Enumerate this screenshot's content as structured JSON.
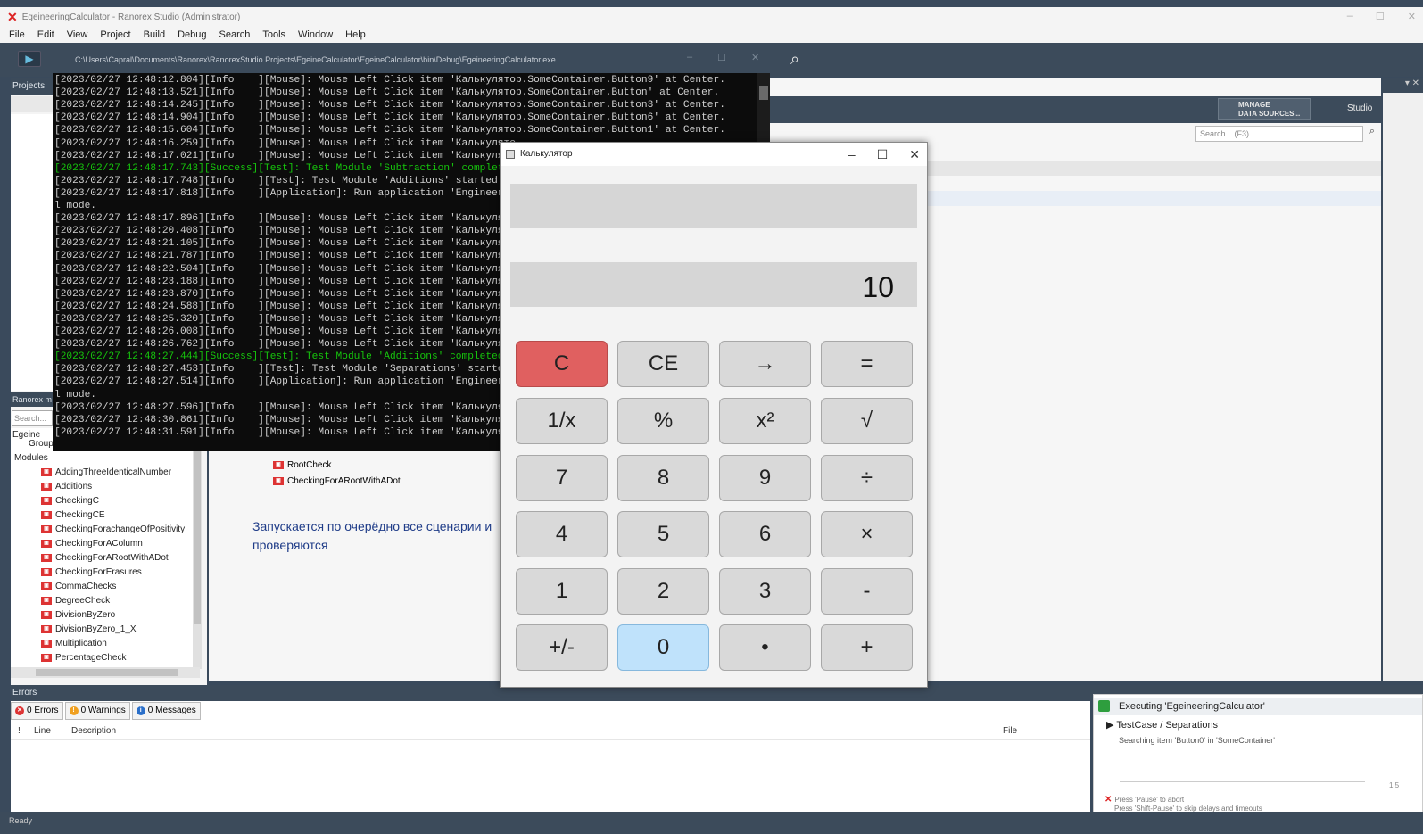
{
  "window": {
    "title": "EgeineeringCalculator - Ranorex Studio (Administrator)",
    "minimize": "–",
    "maximize": "☐",
    "close": "✕"
  },
  "menu": [
    "File",
    "Edit",
    "View",
    "Project",
    "Build",
    "Debug",
    "Search",
    "Tools",
    "Window",
    "Help"
  ],
  "toolbar": {
    "path": "C:\\Users\\Capral\\Documents\\Ranorex\\RanorexStudio Projects\\EgeineCalculator\\EgeineCalculator\\bin\\Debug\\EgeineeringCalculator.exe",
    "run_icon": "▶",
    "ctl_min": "–",
    "ctl_max": "☐",
    "ctl_close": "✕"
  },
  "projects_panel": {
    "title": "Projects"
  },
  "module_panel": {
    "title": "Ranorex m",
    "search_placeholder": "Search...",
    "root": "Egeine",
    "group": "Group",
    "modules_label": "Modules",
    "modules": [
      "AddingThreeIdenticalNumber",
      "Additions",
      "CheckingC",
      "CheckingCE",
      "CheckingForachangeOfPositivity",
      "CheckingForAColumn",
      "CheckingForARootWithADot",
      "CheckingForErasures",
      "CommaChecks",
      "DegreeCheck",
      "DivisionByZero",
      "DivisionByZero_1_X",
      "Multiplication",
      "PercentageCheck"
    ]
  },
  "console": {
    "lines": [
      {
        "t": "[2023/02/27 12:48:12.804][Info    ][Mouse]: Mouse Left Click item 'Калькулятор.SomeContainer.Button9' at Center.",
        "s": false
      },
      {
        "t": "[2023/02/27 12:48:13.521][Info    ][Mouse]: Mouse Left Click item 'Калькулятор.SomeContainer.Button' at Center.",
        "s": false
      },
      {
        "t": "[2023/02/27 12:48:14.245][Info    ][Mouse]: Mouse Left Click item 'Калькулятор.SomeContainer.Button3' at Center.",
        "s": false
      },
      {
        "t": "[2023/02/27 12:48:14.904][Info    ][Mouse]: Mouse Left Click item 'Калькулятор.SomeContainer.Button6' at Center.",
        "s": false
      },
      {
        "t": "[2023/02/27 12:48:15.604][Info    ][Mouse]: Mouse Left Click item 'Калькулятор.SomeContainer.Button1' at Center.",
        "s": false
      },
      {
        "t": "[2023/02/27 12:48:16.259][Info    ][Mouse]: Mouse Left Click item 'Калькулято",
        "s": false
      },
      {
        "t": "[2023/02/27 12:48:17.021][Info    ][Mouse]: Mouse Left Click item 'Калькулято",
        "s": false
      },
      {
        "t": "[2023/02/27 12:48:17.743][Success][Test]: Test Module 'Subtraction' complete",
        "s": true
      },
      {
        "t": "[2023/02/27 12:48:17.748][Info    ][Test]: Test Module 'Additions' started.",
        "s": false
      },
      {
        "t": "[2023/02/27 12:48:17.818][Info    ][Application]: Run application 'Engineerin",
        "s": false
      },
      {
        "t": "l mode.",
        "s": false
      },
      {
        "t": "[2023/02/27 12:48:17.896][Info    ][Mouse]: Mouse Left Click item 'Калькулято",
        "s": false
      },
      {
        "t": "[2023/02/27 12:48:20.408][Info    ][Mouse]: Mouse Left Click item 'Калькулято",
        "s": false
      },
      {
        "t": "[2023/02/27 12:48:21.105][Info    ][Mouse]: Mouse Left Click item 'Калькулято",
        "s": false
      },
      {
        "t": "[2023/02/27 12:48:21.787][Info    ][Mouse]: Mouse Left Click item 'Калькулято",
        "s": false
      },
      {
        "t": "[2023/02/27 12:48:22.504][Info    ][Mouse]: Mouse Left Click item 'Калькулято",
        "s": false
      },
      {
        "t": "[2023/02/27 12:48:23.188][Info    ][Mouse]: Mouse Left Click item 'Калькулято",
        "s": false
      },
      {
        "t": "[2023/02/27 12:48:23.870][Info    ][Mouse]: Mouse Left Click item 'Калькулято",
        "s": false
      },
      {
        "t": "[2023/02/27 12:48:24.588][Info    ][Mouse]: Mouse Left Click item 'Калькулято",
        "s": false
      },
      {
        "t": "[2023/02/27 12:48:25.320][Info    ][Mouse]: Mouse Left Click item 'Калькулято",
        "s": false
      },
      {
        "t": "[2023/02/27 12:48:26.008][Info    ][Mouse]: Mouse Left Click item 'Калькулято",
        "s": false
      },
      {
        "t": "[2023/02/27 12:48:26.762][Info    ][Mouse]: Mouse Left Click item 'Калькулято",
        "s": false
      },
      {
        "t": "[2023/02/27 12:48:27.444][Success][Test]: Test Module 'Additions' completed",
        "s": true
      },
      {
        "t": "[2023/02/27 12:48:27.453][Info    ][Test]: Test Module 'Separations' started.",
        "s": false
      },
      {
        "t": "[2023/02/27 12:48:27.514][Info    ][Application]: Run application 'Engineerin",
        "s": false
      },
      {
        "t": "l mode.",
        "s": false
      },
      {
        "t": "[2023/02/27 12:48:27.596][Info    ][Mouse]: Mouse Left Click item 'Калькулято",
        "s": false
      },
      {
        "t": "[2023/02/27 12:48:30.861][Info    ][Mouse]: Mouse Left Click item 'Калькулято",
        "s": false
      },
      {
        "t": "[2023/02/27 12:48:31.591][Info    ][Mouse]: Mouse Left Click item 'Калькулято",
        "s": false
      }
    ]
  },
  "center": {
    "manage_btn": "MANAGE\nDATA SOURCES...",
    "studio_btn": "Studio",
    "search_placeholder": "Search... (F3)",
    "tree_items": [
      "RootCheck",
      "CheckingForARootWithADot"
    ],
    "note": "Запускается по очерёдно все сценарии и проверяются"
  },
  "calculator": {
    "title": "Калькулятор",
    "display_top": "",
    "display_value": "10",
    "buttons": [
      {
        "label": "C",
        "style": "red"
      },
      {
        "label": "CE",
        "style": ""
      },
      {
        "label": "→",
        "style": ""
      },
      {
        "label": "=",
        "style": ""
      },
      {
        "label": "1/x",
        "style": ""
      },
      {
        "label": "%",
        "style": ""
      },
      {
        "label": "x²",
        "style": ""
      },
      {
        "label": "√",
        "style": ""
      },
      {
        "label": "7",
        "style": ""
      },
      {
        "label": "8",
        "style": ""
      },
      {
        "label": "9",
        "style": ""
      },
      {
        "label": "÷",
        "style": ""
      },
      {
        "label": "4",
        "style": ""
      },
      {
        "label": "5",
        "style": ""
      },
      {
        "label": "6",
        "style": ""
      },
      {
        "label": "×",
        "style": ""
      },
      {
        "label": "1",
        "style": ""
      },
      {
        "label": "2",
        "style": ""
      },
      {
        "label": "3",
        "style": ""
      },
      {
        "label": "-",
        "style": ""
      },
      {
        "label": "+/-",
        "style": ""
      },
      {
        "label": "0",
        "style": "blue"
      },
      {
        "label": "•",
        "style": ""
      },
      {
        "label": "+",
        "style": ""
      }
    ]
  },
  "errors": {
    "title": "Errors",
    "tab_errors": "0 Errors",
    "tab_warnings": "0 Warnings",
    "tab_messages": "0 Messages",
    "col_num": "!",
    "col_line": "Line",
    "col_desc": "Description",
    "col_file": "File"
  },
  "exec": {
    "title": "Executing 'EgeineeringCalculator'",
    "testcase": "TestCase / Separations",
    "status": "Searching item 'Button0' in 'SomeContainer'",
    "progress_value": "1.5",
    "abort1": "Press 'Pause' to abort",
    "abort2": "Press 'Shift-Pause' to skip delays and timeouts"
  },
  "status": {
    "text": "Ready"
  }
}
